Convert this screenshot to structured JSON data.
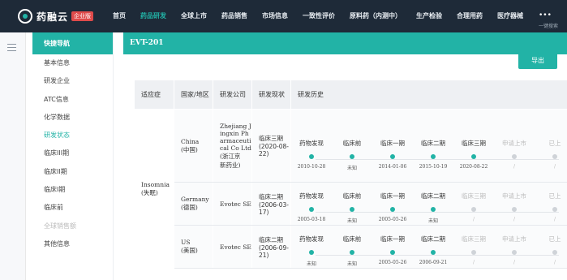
{
  "brand": {
    "name": "药融云",
    "badge": "企业版"
  },
  "nav": {
    "items": [
      "首页",
      "药品研发",
      "全球上市",
      "药品销售",
      "市场信息",
      "一致性评价",
      "原料药（内测中）",
      "生产检验",
      "合理用药",
      "医疗器械"
    ],
    "active_index": 1,
    "more": "•••",
    "search_label": "一键搜索"
  },
  "sidebar": {
    "header": "快捷导航",
    "items": [
      {
        "label": "基本信息",
        "state": "normal"
      },
      {
        "label": "研发企业",
        "state": "normal"
      },
      {
        "label": "ATC信息",
        "state": "normal"
      },
      {
        "label": "化学数据",
        "state": "normal"
      },
      {
        "label": "研发状态",
        "state": "active"
      },
      {
        "label": "临床III期",
        "state": "normal"
      },
      {
        "label": "临床II期",
        "state": "normal"
      },
      {
        "label": "临床I期",
        "state": "normal"
      },
      {
        "label": "临床前",
        "state": "normal"
      },
      {
        "label": "全球销售额",
        "state": "disabled"
      },
      {
        "label": "其他信息",
        "state": "normal"
      }
    ]
  },
  "main": {
    "title": "EVT-201",
    "export_label": "导出",
    "table": {
      "headers": [
        "适应症",
        "国家/地区",
        "研发公司",
        "研发现状",
        "研发历史"
      ],
      "indication": "Insomnia\n(失眠)",
      "rows": [
        {
          "country": "China\n(中国)",
          "company": "Zhejiang J\ningxin Ph\narmaceuti\ncal Co Ltd\n(浙江京\n新药业)",
          "status": "临床三期\n(2020-08-\n22)",
          "stages": [
            {
              "label": "药物发现",
              "date": "2010-10-28",
              "done": true
            },
            {
              "label": "临床前",
              "date": "未知",
              "done": true
            },
            {
              "label": "临床一期",
              "date": "2014-01-06",
              "done": true
            },
            {
              "label": "临床二期",
              "date": "2015-10-19",
              "done": true
            },
            {
              "label": "临床三期",
              "date": "2020-08-22",
              "done": true
            },
            {
              "label": "申请上市",
              "date": "/",
              "done": false
            },
            {
              "label": "已上",
              "date": "/",
              "done": false
            }
          ]
        },
        {
          "country": "Germany\n(德国)",
          "company": "Evotec SE",
          "status": "临床二期\n(2006-03-\n17)",
          "stages": [
            {
              "label": "药物发现",
              "date": "2005-03-18",
              "done": true
            },
            {
              "label": "临床前",
              "date": "未知",
              "done": true
            },
            {
              "label": "临床一期",
              "date": "2005-05-26",
              "done": true
            },
            {
              "label": "临床二期",
              "date": "未知",
              "done": true
            },
            {
              "label": "临床三期",
              "date": "/",
              "done": false
            },
            {
              "label": "申请上市",
              "date": "/",
              "done": false
            },
            {
              "label": "已上",
              "date": "/",
              "done": false
            }
          ]
        },
        {
          "country": "US\n(美国)",
          "company": "Evotec SE",
          "status": "临床二期\n(2006-09-\n21)",
          "stages": [
            {
              "label": "药物发现",
              "date": "未知",
              "done": true
            },
            {
              "label": "临床前",
              "date": "未知",
              "done": true
            },
            {
              "label": "临床一期",
              "date": "2005-05-26",
              "done": true
            },
            {
              "label": "临床二期",
              "date": "2006-09-21",
              "done": true
            },
            {
              "label": "临床三期",
              "date": "/",
              "done": false
            },
            {
              "label": "申请上市",
              "date": "/",
              "done": false
            },
            {
              "label": "已上",
              "date": "/",
              "done": false
            }
          ]
        }
      ]
    }
  },
  "colors": {
    "accent": "#22b3a6",
    "topbar": "#1e2a38",
    "badge": "#e04b4b",
    "pending": "#cfd3d8"
  }
}
